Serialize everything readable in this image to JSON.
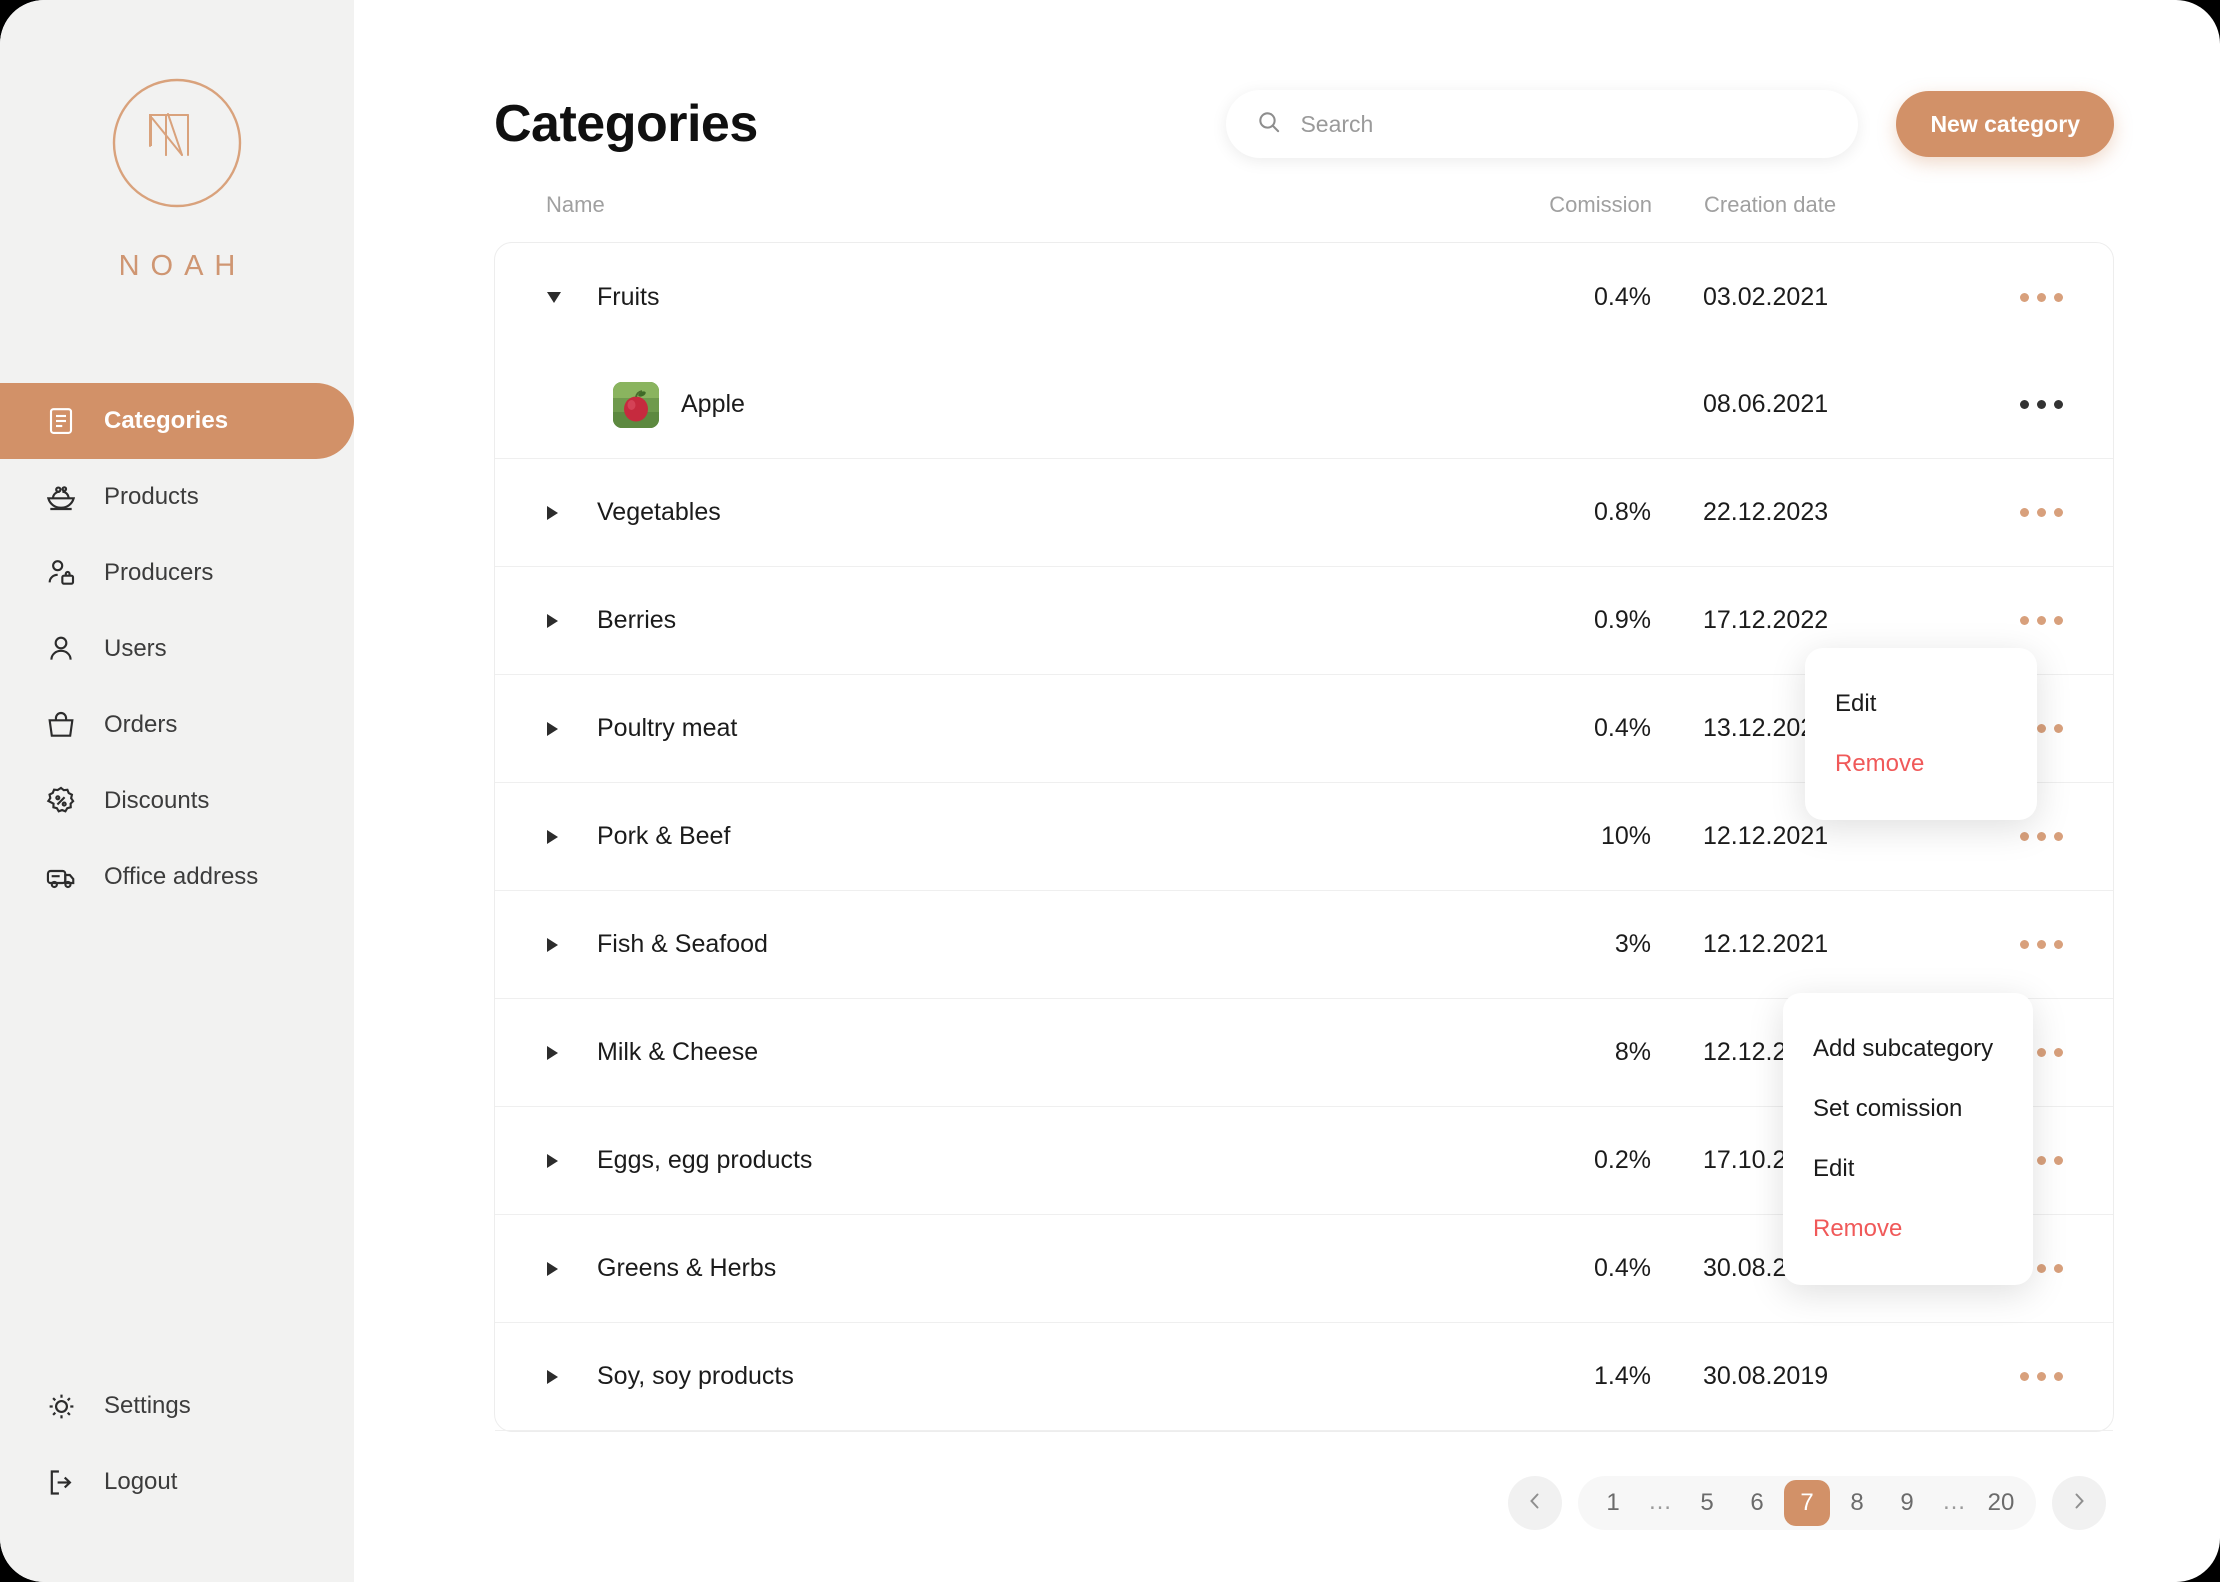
{
  "brand": {
    "name": "NOAH",
    "accent": "#d29168",
    "logo_icon": "noah-monogram-icon"
  },
  "sidebar": {
    "items": [
      {
        "label": "Categories",
        "icon": "document-list-icon",
        "active": true
      },
      {
        "label": "Products",
        "icon": "salad-bowl-icon",
        "active": false
      },
      {
        "label": "Producers",
        "icon": "person-briefcase-icon",
        "active": false
      },
      {
        "label": "Users",
        "icon": "person-icon",
        "active": false
      },
      {
        "label": "Orders",
        "icon": "shopping-bag-icon",
        "active": false
      },
      {
        "label": "Discounts",
        "icon": "discount-badge-icon",
        "active": false
      },
      {
        "label": "Office address",
        "icon": "delivery-truck-icon",
        "active": false
      }
    ],
    "bottom_items": [
      {
        "label": "Settings",
        "icon": "gear-icon"
      },
      {
        "label": "Logout",
        "icon": "logout-icon"
      }
    ]
  },
  "header": {
    "title": "Categories",
    "search": {
      "placeholder": "Search",
      "value": "",
      "icon": "search-icon"
    },
    "new_category_label": "New category"
  },
  "table": {
    "columns": {
      "name": "Name",
      "commission": "Comission",
      "creation_date": "Creation date"
    },
    "rows": [
      {
        "name": "Fruits",
        "commission": "0.4%",
        "date": "03.02.2021",
        "expanded": true,
        "child": false,
        "thumb": false,
        "dots": "orange"
      },
      {
        "name": "Apple",
        "commission": "",
        "date": "08.06.2021",
        "expanded": false,
        "child": true,
        "thumb": true,
        "dots": "dark",
        "thumb_icon": "apple-photo-icon"
      },
      {
        "name": "Vegetables",
        "commission": "0.8%",
        "date": "22.12.2023",
        "expanded": false,
        "child": false,
        "thumb": false,
        "dots": "orange"
      },
      {
        "name": "Berries",
        "commission": "0.9%",
        "date": "17.12.2022",
        "expanded": false,
        "child": false,
        "thumb": false,
        "dots": "orange"
      },
      {
        "name": "Poultry meat",
        "commission": "0.4%",
        "date": "13.12.2022",
        "expanded": false,
        "child": false,
        "thumb": false,
        "dots": "orange"
      },
      {
        "name": "Pork & Beef",
        "commission": "10%",
        "date": "12.12.2021",
        "expanded": false,
        "child": false,
        "thumb": false,
        "dots": "orange"
      },
      {
        "name": "Fish & Seafood",
        "commission": "3%",
        "date": "12.12.2021",
        "expanded": false,
        "child": false,
        "thumb": false,
        "dots": "orange"
      },
      {
        "name": "Milk & Cheese",
        "commission": "8%",
        "date": "12.12.2020",
        "expanded": false,
        "child": false,
        "thumb": false,
        "dots": "orange"
      },
      {
        "name": "Eggs, egg products",
        "commission": "0.2%",
        "date": "17.10.2019",
        "expanded": false,
        "child": false,
        "thumb": false,
        "dots": "orange"
      },
      {
        "name": "Greens & Herbs",
        "commission": "0.4%",
        "date": "30.08.2019",
        "expanded": false,
        "child": false,
        "thumb": false,
        "dots": "orange"
      },
      {
        "name": "Soy, soy products",
        "commission": "1.4%",
        "date": "30.08.2019",
        "expanded": false,
        "child": false,
        "thumb": false,
        "dots": "orange"
      }
    ]
  },
  "menus": {
    "row_menu": {
      "items": [
        "Edit",
        "Remove"
      ]
    },
    "category_menu": {
      "items": [
        "Add subcategory",
        "Set comission",
        "Edit",
        "Remove"
      ]
    }
  },
  "pagination": {
    "prev_icon": "chevron-left-icon",
    "next_icon": "chevron-right-icon",
    "pages": [
      "1",
      "…",
      "5",
      "6",
      "7",
      "8",
      "9",
      "…",
      "20"
    ],
    "current": "7"
  }
}
